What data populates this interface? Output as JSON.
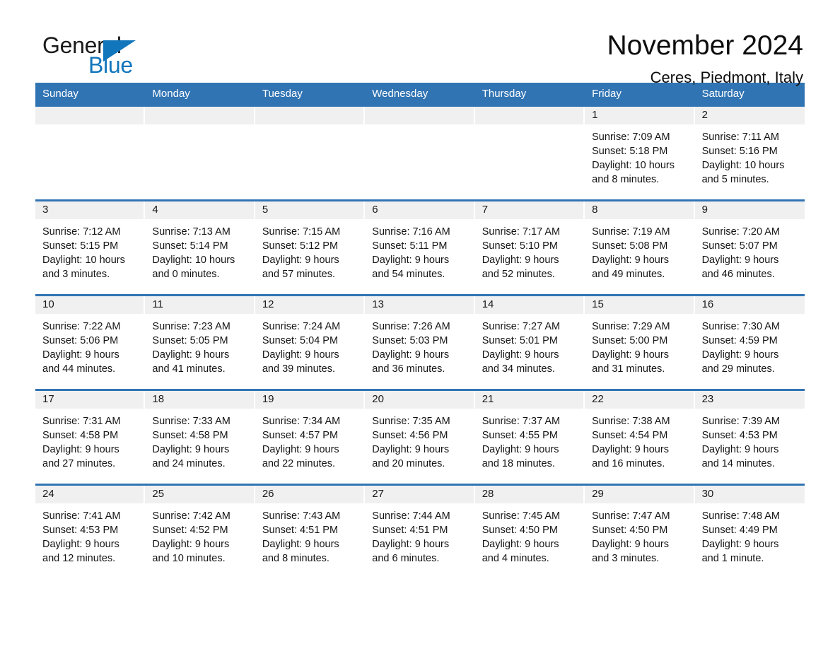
{
  "brand": {
    "name_part1": "General",
    "name_part2": "Blue",
    "triangle_color": "#1176bc"
  },
  "header": {
    "title": "November 2024",
    "subtitle": "Ceres, Piedmont, Italy"
  },
  "colors": {
    "header_blue": "#3174b3",
    "day_band_gray": "#f0f0f0",
    "brand_blue": "#1176bc"
  },
  "weekdays": [
    "Sunday",
    "Monday",
    "Tuesday",
    "Wednesday",
    "Thursday",
    "Friday",
    "Saturday"
  ],
  "labels": {
    "sunrise_prefix": "Sunrise: ",
    "sunset_prefix": "Sunset: ",
    "daylight_prefix": "Daylight: "
  },
  "weeks": [
    [
      {
        "day": "",
        "empty": true
      },
      {
        "day": "",
        "empty": true
      },
      {
        "day": "",
        "empty": true
      },
      {
        "day": "",
        "empty": true
      },
      {
        "day": "",
        "empty": true
      },
      {
        "day": "1",
        "sunrise": "Sunrise: 7:09 AM",
        "sunset": "Sunset: 5:18 PM",
        "daylight": "Daylight: 10 hours and 8 minutes."
      },
      {
        "day": "2",
        "sunrise": "Sunrise: 7:11 AM",
        "sunset": "Sunset: 5:16 PM",
        "daylight": "Daylight: 10 hours and 5 minutes."
      }
    ],
    [
      {
        "day": "3",
        "sunrise": "Sunrise: 7:12 AM",
        "sunset": "Sunset: 5:15 PM",
        "daylight": "Daylight: 10 hours and 3 minutes."
      },
      {
        "day": "4",
        "sunrise": "Sunrise: 7:13 AM",
        "sunset": "Sunset: 5:14 PM",
        "daylight": "Daylight: 10 hours and 0 minutes."
      },
      {
        "day": "5",
        "sunrise": "Sunrise: 7:15 AM",
        "sunset": "Sunset: 5:12 PM",
        "daylight": "Daylight: 9 hours and 57 minutes."
      },
      {
        "day": "6",
        "sunrise": "Sunrise: 7:16 AM",
        "sunset": "Sunset: 5:11 PM",
        "daylight": "Daylight: 9 hours and 54 minutes."
      },
      {
        "day": "7",
        "sunrise": "Sunrise: 7:17 AM",
        "sunset": "Sunset: 5:10 PM",
        "daylight": "Daylight: 9 hours and 52 minutes."
      },
      {
        "day": "8",
        "sunrise": "Sunrise: 7:19 AM",
        "sunset": "Sunset: 5:08 PM",
        "daylight": "Daylight: 9 hours and 49 minutes."
      },
      {
        "day": "9",
        "sunrise": "Sunrise: 7:20 AM",
        "sunset": "Sunset: 5:07 PM",
        "daylight": "Daylight: 9 hours and 46 minutes."
      }
    ],
    [
      {
        "day": "10",
        "sunrise": "Sunrise: 7:22 AM",
        "sunset": "Sunset: 5:06 PM",
        "daylight": "Daylight: 9 hours and 44 minutes."
      },
      {
        "day": "11",
        "sunrise": "Sunrise: 7:23 AM",
        "sunset": "Sunset: 5:05 PM",
        "daylight": "Daylight: 9 hours and 41 minutes."
      },
      {
        "day": "12",
        "sunrise": "Sunrise: 7:24 AM",
        "sunset": "Sunset: 5:04 PM",
        "daylight": "Daylight: 9 hours and 39 minutes."
      },
      {
        "day": "13",
        "sunrise": "Sunrise: 7:26 AM",
        "sunset": "Sunset: 5:03 PM",
        "daylight": "Daylight: 9 hours and 36 minutes."
      },
      {
        "day": "14",
        "sunrise": "Sunrise: 7:27 AM",
        "sunset": "Sunset: 5:01 PM",
        "daylight": "Daylight: 9 hours and 34 minutes."
      },
      {
        "day": "15",
        "sunrise": "Sunrise: 7:29 AM",
        "sunset": "Sunset: 5:00 PM",
        "daylight": "Daylight: 9 hours and 31 minutes."
      },
      {
        "day": "16",
        "sunrise": "Sunrise: 7:30 AM",
        "sunset": "Sunset: 4:59 PM",
        "daylight": "Daylight: 9 hours and 29 minutes."
      }
    ],
    [
      {
        "day": "17",
        "sunrise": "Sunrise: 7:31 AM",
        "sunset": "Sunset: 4:58 PM",
        "daylight": "Daylight: 9 hours and 27 minutes."
      },
      {
        "day": "18",
        "sunrise": "Sunrise: 7:33 AM",
        "sunset": "Sunset: 4:58 PM",
        "daylight": "Daylight: 9 hours and 24 minutes."
      },
      {
        "day": "19",
        "sunrise": "Sunrise: 7:34 AM",
        "sunset": "Sunset: 4:57 PM",
        "daylight": "Daylight: 9 hours and 22 minutes."
      },
      {
        "day": "20",
        "sunrise": "Sunrise: 7:35 AM",
        "sunset": "Sunset: 4:56 PM",
        "daylight": "Daylight: 9 hours and 20 minutes."
      },
      {
        "day": "21",
        "sunrise": "Sunrise: 7:37 AM",
        "sunset": "Sunset: 4:55 PM",
        "daylight": "Daylight: 9 hours and 18 minutes."
      },
      {
        "day": "22",
        "sunrise": "Sunrise: 7:38 AM",
        "sunset": "Sunset: 4:54 PM",
        "daylight": "Daylight: 9 hours and 16 minutes."
      },
      {
        "day": "23",
        "sunrise": "Sunrise: 7:39 AM",
        "sunset": "Sunset: 4:53 PM",
        "daylight": "Daylight: 9 hours and 14 minutes."
      }
    ],
    [
      {
        "day": "24",
        "sunrise": "Sunrise: 7:41 AM",
        "sunset": "Sunset: 4:53 PM",
        "daylight": "Daylight: 9 hours and 12 minutes."
      },
      {
        "day": "25",
        "sunrise": "Sunrise: 7:42 AM",
        "sunset": "Sunset: 4:52 PM",
        "daylight": "Daylight: 9 hours and 10 minutes."
      },
      {
        "day": "26",
        "sunrise": "Sunrise: 7:43 AM",
        "sunset": "Sunset: 4:51 PM",
        "daylight": "Daylight: 9 hours and 8 minutes."
      },
      {
        "day": "27",
        "sunrise": "Sunrise: 7:44 AM",
        "sunset": "Sunset: 4:51 PM",
        "daylight": "Daylight: 9 hours and 6 minutes."
      },
      {
        "day": "28",
        "sunrise": "Sunrise: 7:45 AM",
        "sunset": "Sunset: 4:50 PM",
        "daylight": "Daylight: 9 hours and 4 minutes."
      },
      {
        "day": "29",
        "sunrise": "Sunrise: 7:47 AM",
        "sunset": "Sunset: 4:50 PM",
        "daylight": "Daylight: 9 hours and 3 minutes."
      },
      {
        "day": "30",
        "sunrise": "Sunrise: 7:48 AM",
        "sunset": "Sunset: 4:49 PM",
        "daylight": "Daylight: 9 hours and 1 minute."
      }
    ]
  ]
}
